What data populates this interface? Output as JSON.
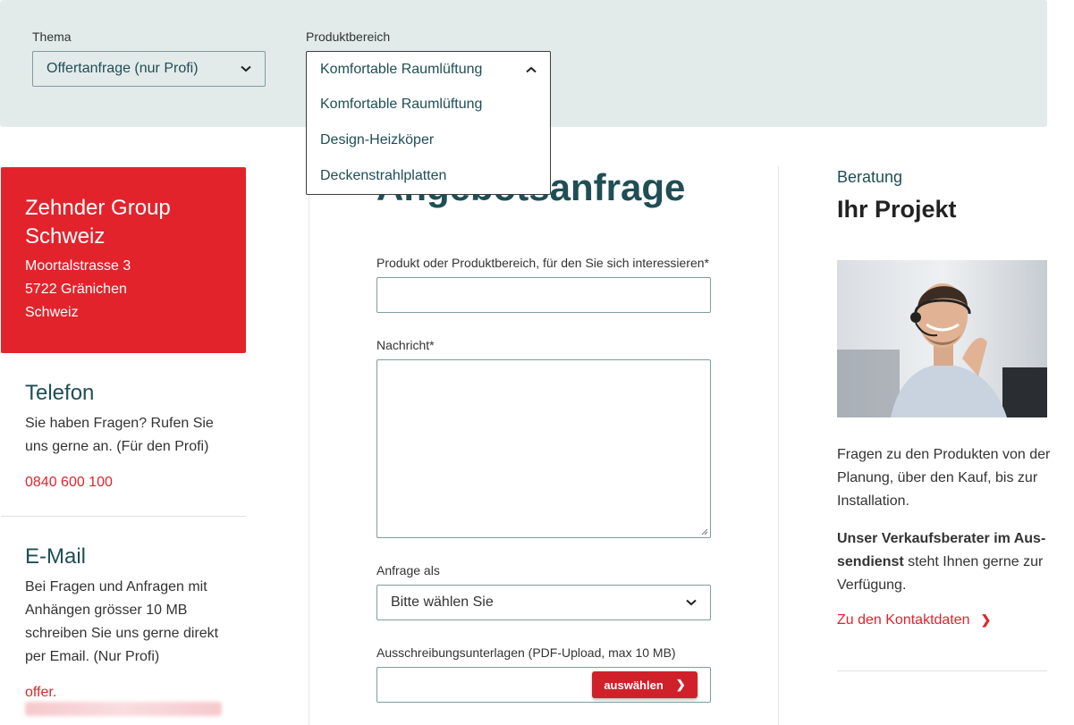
{
  "filters": {
    "thema_label": "Thema",
    "thema_value": "Offertanfrage (nur Profi)",
    "produkt_label": "Produktbereich",
    "produkt_value": "Komfortable Raumlüftung",
    "produkt_options": [
      "Komfortable Raumlüftung",
      "Design-Heizköper",
      "Deckenstrahlplatten"
    ]
  },
  "address": {
    "company": "Zehnder Group Schweiz",
    "street": "Moortalstrasse 3",
    "city": "5722 Gränichen",
    "country": "Schweiz"
  },
  "phone": {
    "heading": "Telefon",
    "text": "Sie haben Fragen? Rufen Sie uns gerne an. (Für den Profi)",
    "number": "0840 600 100"
  },
  "email": {
    "heading": "E-Mail",
    "text": "Bei Fragen und Anfragen mit Anhängen grösser 10 MB schreiben Sie uns gerne direkt per Email. (Nur Profi)",
    "address_prefix": "offer."
  },
  "form": {
    "title": "Angebotsanfrage",
    "product_label": "Produkt oder Produktbereich, für den Sie sich interessieren*",
    "message_label": "Nachricht*",
    "request_as_label": "Anfrage als",
    "request_as_value": "Bitte wählen Sie",
    "upload_label": "Ausschreibungsunterlagen (PDF-Upload, max 10 MB)",
    "upload_button": "auswählen"
  },
  "advice": {
    "kicker": "Beratung",
    "title": "Ihr Projekt",
    "text1": "Fragen zu den Produkten   von der Planung, über den Kauf, bis zur Installation.",
    "text2_bold": "Unser Verkaufsberater im Aus­sendienst",
    "text2_rest": " steht Ihnen gerne zur Verfügung.",
    "link": "Zu den Kontaktdaten"
  },
  "colors": {
    "brand_red": "#e3232c",
    "teal": "#1f4e55",
    "filter_bg": "#e3eaea"
  }
}
